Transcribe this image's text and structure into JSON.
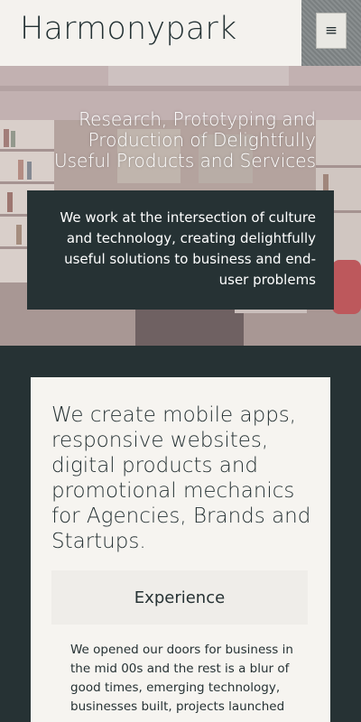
{
  "header": {
    "brand": "Harmonypark",
    "menu_icon": "hamburger-menu-icon",
    "menu_glyph": "≡"
  },
  "hero": {
    "tagline": "Research, Prototyping and Production of Delightfully Useful Products and Services",
    "intro": "We work at the intersection of culture and technology, creating delightfully useful solutions to business and end-user problems"
  },
  "main": {
    "headline": "We create mobile apps, responsive websites, digital products and promotional mechanics for Agencies, Brands and Startups.",
    "panel": {
      "title": "Experience",
      "body": "We opened our doors for business in the mid 00s and the rest is a blur of good times, emerging technology, businesses built, projects launched"
    }
  },
  "colors": {
    "dark": "#263234",
    "light": "#f4f2ee"
  }
}
